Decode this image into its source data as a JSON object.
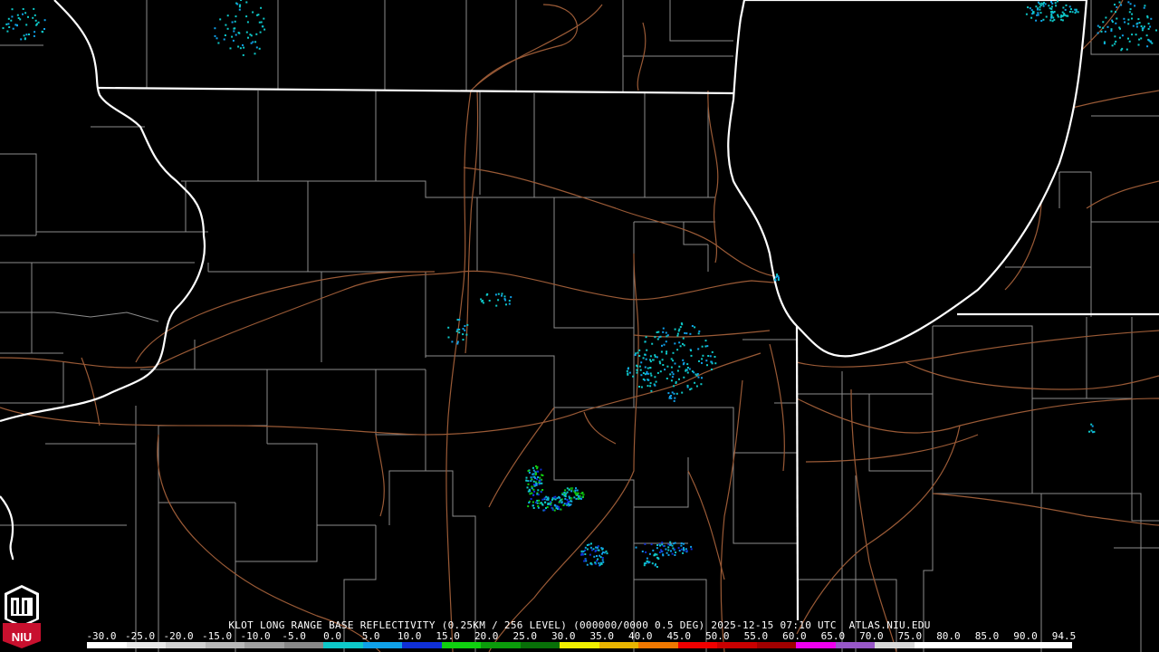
{
  "caption": "KLOT LONG RANGE BASE REFLECTIVITY (0.25KM / 256 LEVEL) (000000/0000 0.5 DEG) 2025-12-15 07:10 UTC  ATLAS.NIU.EDU",
  "scale": {
    "labels": [
      "-30.0",
      "-25.0",
      "-20.0",
      "-15.0",
      "-10.0",
      "-5.0",
      "0.0",
      "5.0",
      "10.0",
      "15.0",
      "20.0",
      "25.0",
      "30.0",
      "35.0",
      "40.0",
      "45.0",
      "50.0",
      "55.0",
      "60.0",
      "65.0",
      "70.0",
      "75.0",
      "80.0",
      "85.0",
      "90.0",
      "94.5"
    ],
    "colors": [
      "#ffffff",
      "#e8e8e8",
      "#d0d0d0",
      "#b8b8b8",
      "#a0a0a0",
      "#888888",
      "#0ec8c8",
      "#10a0e8",
      "#1030d8",
      "#10d010",
      "#0b9c0b",
      "#087008",
      "#f0f000",
      "#e8b400",
      "#f07800",
      "#f00000",
      "#c80000",
      "#a00000",
      "#f000f0",
      "#9858c8",
      "#d8d8d8",
      "#ffffff",
      "#ffffff",
      "#ffffff",
      "#ffffff"
    ]
  },
  "logo": {
    "text": "NIU",
    "colors": {
      "primary": "#c8102e",
      "secondary": "#ffffff"
    }
  },
  "map": {
    "colors": {
      "background": "#000000",
      "state_borders": "#ffffff",
      "county_lines": "#8c8c8c",
      "roads": "#9a5a36",
      "lake": "#000000"
    },
    "echo_colors": [
      "#0ec8c8",
      "#10a0e8",
      "#1030d8",
      "#10d010",
      "#0b9c0b"
    ]
  }
}
